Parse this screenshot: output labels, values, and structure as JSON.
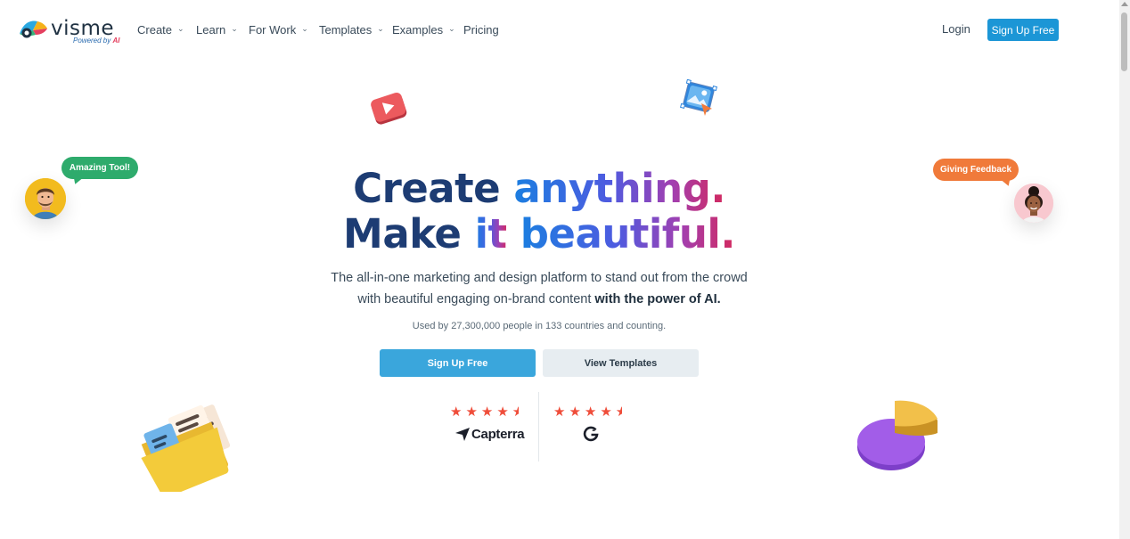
{
  "brand": {
    "name": "visme",
    "tagline_prefix": "Powered by",
    "tagline_ai": "AI"
  },
  "nav": {
    "items": [
      {
        "label": "Create",
        "has_dropdown": true
      },
      {
        "label": "Learn",
        "has_dropdown": true
      },
      {
        "label": "For Work",
        "has_dropdown": true
      },
      {
        "label": "Templates",
        "has_dropdown": true
      },
      {
        "label": "Examples",
        "has_dropdown": true
      },
      {
        "label": "Pricing",
        "has_dropdown": false
      }
    ],
    "login": "Login",
    "signup": "Sign Up Free"
  },
  "hero": {
    "line1_a": "Create",
    "line1_b": "anything.",
    "line2_a": "Make",
    "line2_b": "it",
    "line2_c": "beautiful.",
    "sub_line1": "The all-in-one marketing and design platform to stand out from the crowd",
    "sub_line2_a": "with beautiful engaging on-brand content",
    "sub_line2_b": "with the power of AI.",
    "used_by": "Used by 27,300,000 people in 133 countries and counting.",
    "cta_primary": "Sign Up Free",
    "cta_secondary": "View Templates"
  },
  "ratings": {
    "capterra": {
      "stars": 4.5,
      "name": "Capterra"
    },
    "g2": {
      "stars": 4.5,
      "name": "G2"
    }
  },
  "bubbles": {
    "left": "Amazing Tool!",
    "right": "Giving Feedback"
  },
  "colors": {
    "accent": "#1c96d6",
    "primary_button": "#3aa6dc",
    "title_navy": "#1d3c73",
    "star": "#ef4d3a",
    "bubble_green": "#2eab6c",
    "bubble_orange": "#f07a3a"
  }
}
